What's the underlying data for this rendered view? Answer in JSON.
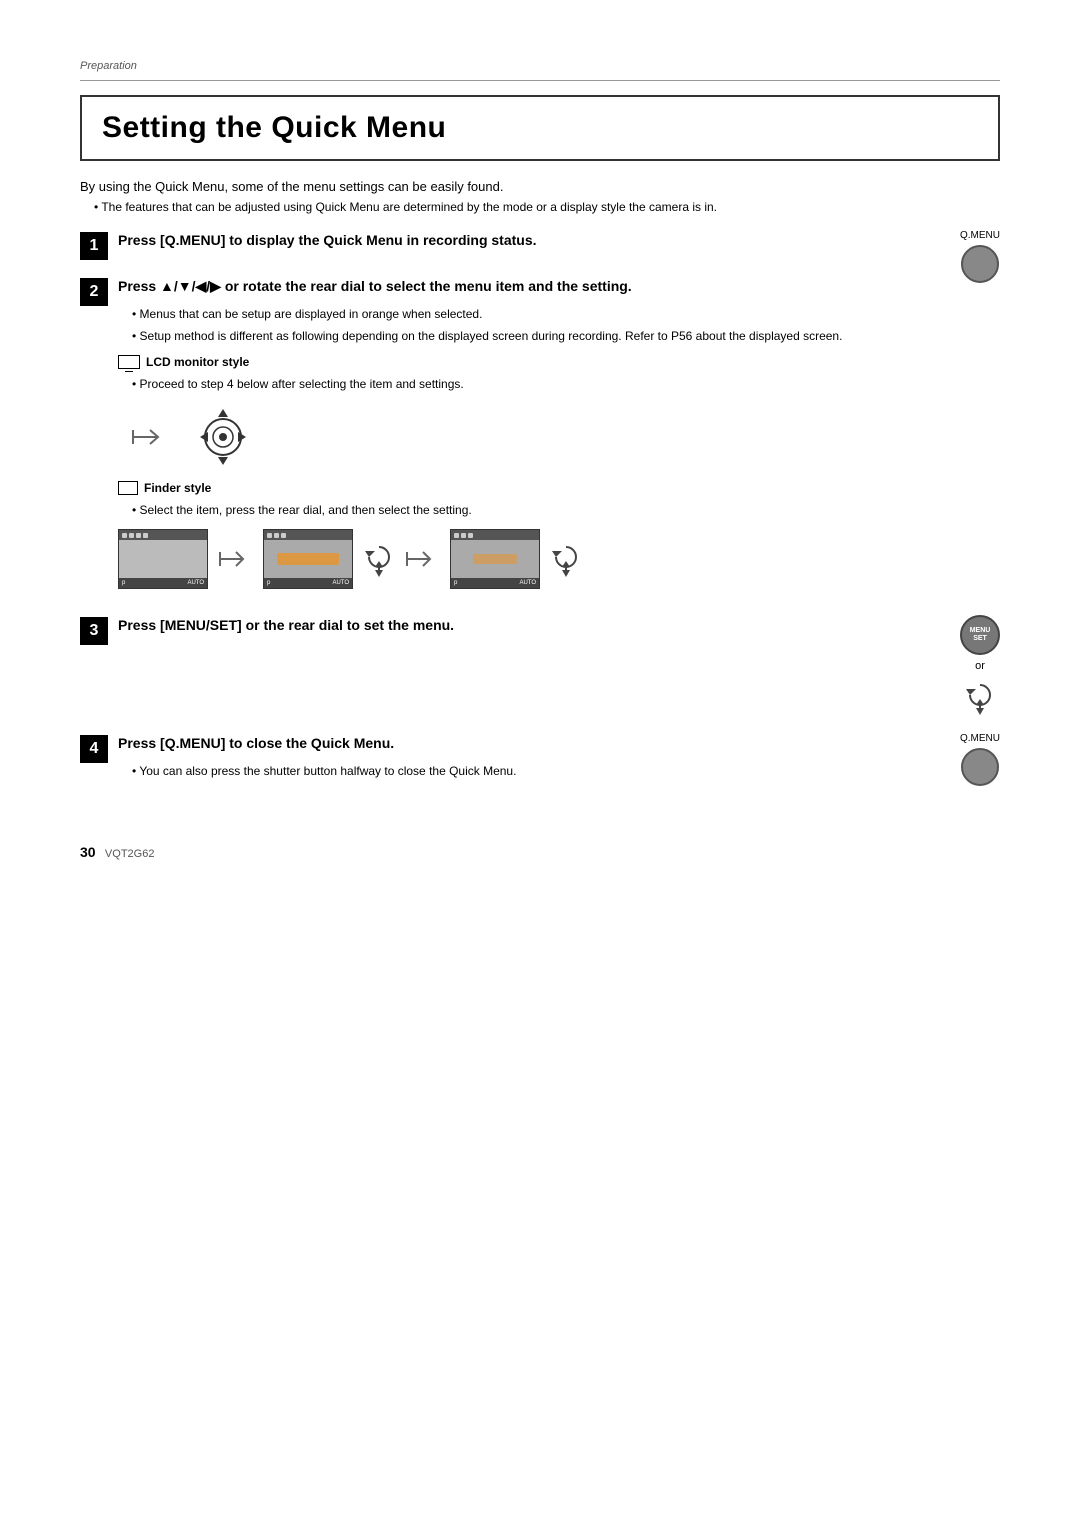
{
  "page": {
    "section_label": "Preparation",
    "title": "Setting the Quick Menu",
    "intro": "By using the Quick Menu, some of the menu settings can be easily found.",
    "intro_bullet": "The features that can be adjusted using Quick Menu are determined by the mode or a display style the camera is in.",
    "steps": [
      {
        "number": "1",
        "text": "Press [Q.MENU] to display the Quick Menu in recording status.",
        "aside_label": "Q.MENU"
      },
      {
        "number": "2",
        "text": "Press ▲/▼/◀/▶ or rotate the rear dial to select the menu item and the setting.",
        "sub_bullets": [
          "Menus that can be setup are displayed in orange when selected.",
          "Setup method is different as following depending on the displayed screen during recording. Refer to P56 about the displayed screen."
        ]
      },
      {
        "number": "3",
        "text": "Press [MENU/SET] or the rear dial to set the menu.",
        "aside_or": "or"
      },
      {
        "number": "4",
        "text": "Press [Q.MENU] to close the Quick Menu.",
        "aside_label": "Q.MENU",
        "sub_bullets": [
          "You can also press the shutter button halfway to close the Quick Menu."
        ]
      }
    ],
    "lcd_monitor_label": "LCD monitor style",
    "lcd_proceed_bullet": "Proceed to step 4 below after selecting the item and settings.",
    "finder_label": "Finder style",
    "finder_bullet": "Select the item, press the rear dial, and then select the setting.",
    "footer": {
      "page_number": "30",
      "doc_code": "VQT2G62"
    }
  }
}
